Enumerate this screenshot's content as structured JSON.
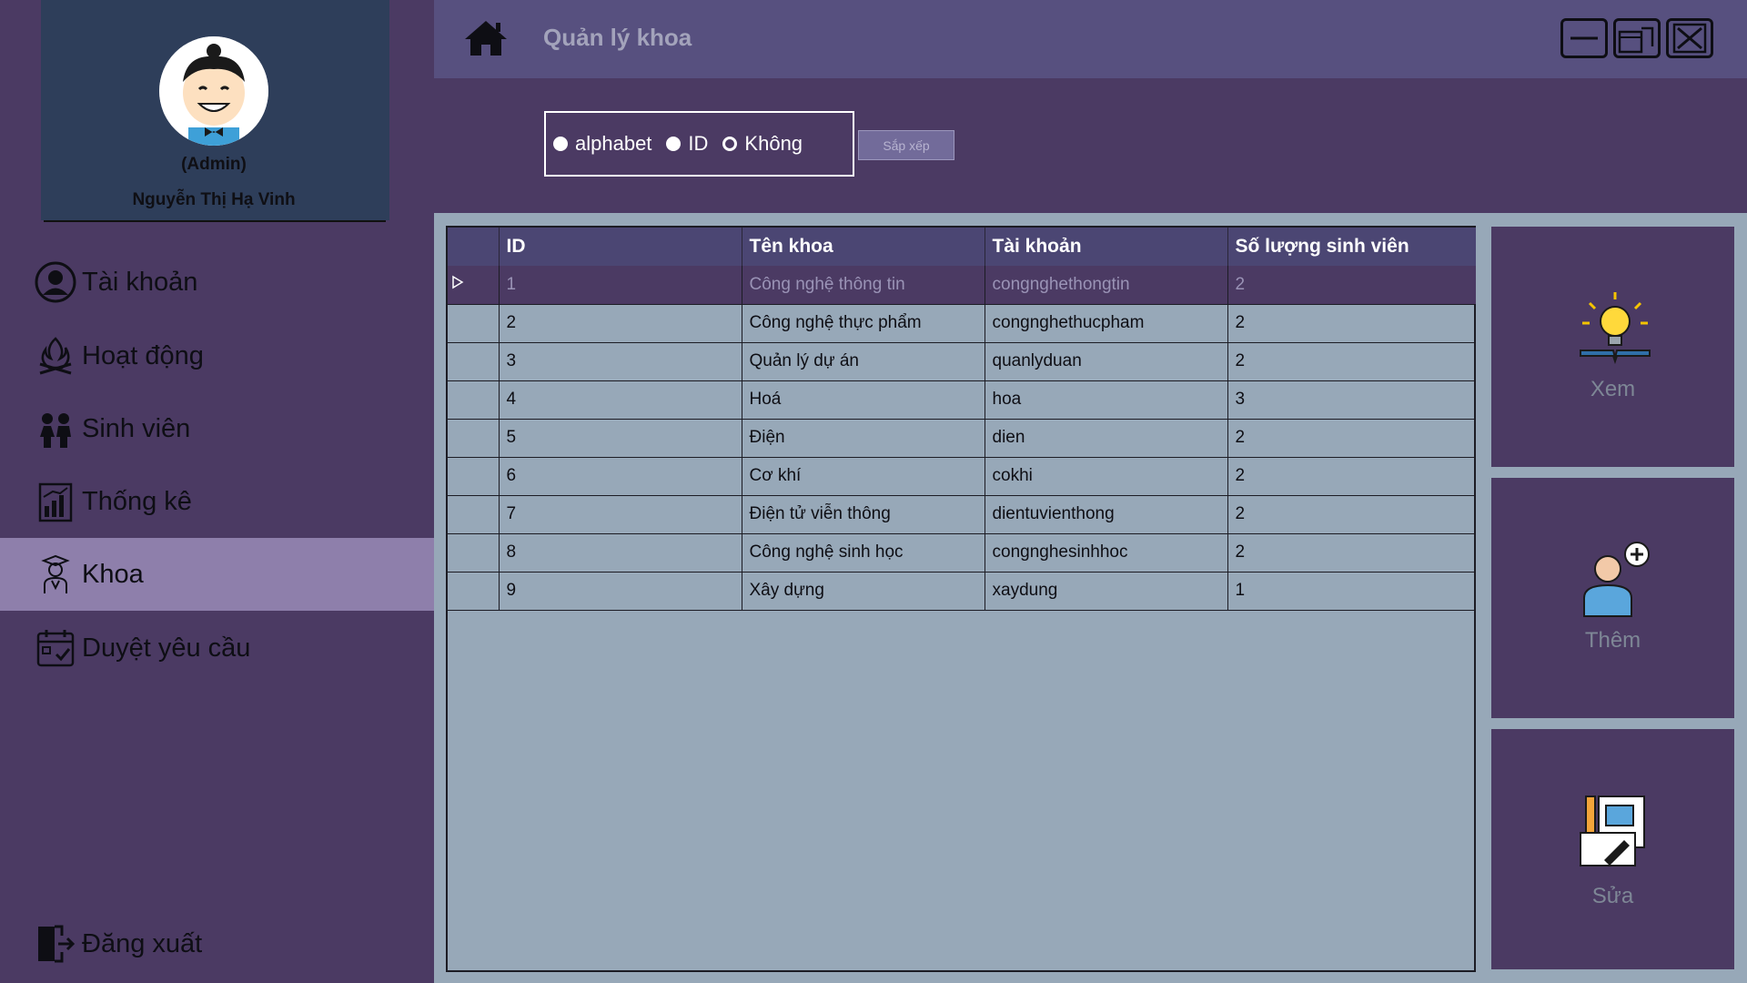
{
  "profile": {
    "role": "(Admin)",
    "name": "Nguyễn Thị Hạ Vinh",
    "avatar_icon": "cartoon-boy-avatar"
  },
  "sidebar": {
    "items": [
      {
        "label": "Tài khoản",
        "icon": "user-circle-icon"
      },
      {
        "label": "Hoạt động",
        "icon": "campfire-icon"
      },
      {
        "label": "Sinh viên",
        "icon": "students-icon"
      },
      {
        "label": "Thống kê",
        "icon": "bar-chart-icon"
      },
      {
        "label": "Khoa",
        "icon": "graduate-icon",
        "active": true
      },
      {
        "label": "Duyệt yêu cầu",
        "icon": "calendar-check-icon"
      }
    ],
    "logout_label": "Đăng xuất"
  },
  "header": {
    "title": "Quản lý khoa"
  },
  "sort": {
    "options": [
      "alphabet",
      "ID",
      "Không"
    ],
    "selected": "Không",
    "button_label": "Sắp xếp"
  },
  "table": {
    "columns": [
      "ID",
      "Tên khoa",
      "Tài khoản",
      "Số lượng sinh viên"
    ],
    "rows": [
      [
        "1",
        "Công nghệ thông tin",
        "congnghethongtin",
        "2"
      ],
      [
        "2",
        "Công nghệ thực phẩm",
        "congnghethucpham",
        "2"
      ],
      [
        "3",
        "Quản lý dự án",
        "quanlyduan",
        "2"
      ],
      [
        "4",
        "Hoá",
        "hoa",
        "3"
      ],
      [
        "5",
        "Điện",
        "dien",
        "2"
      ],
      [
        "6",
        "Cơ khí",
        "cokhi",
        "2"
      ],
      [
        "7",
        "Điện tử viễn thông",
        "dientuvienthong",
        "2"
      ],
      [
        "8",
        "Công nghệ sinh học",
        "congnghesinhhoc",
        "2"
      ],
      [
        "9",
        "Xây dựng",
        "xaydung",
        "1"
      ]
    ],
    "selected_row": 0
  },
  "actions": [
    {
      "label": "Xem",
      "icon": "lightbulb-book-icon"
    },
    {
      "label": "Thêm",
      "icon": "add-user-icon"
    },
    {
      "label": "Sửa",
      "icon": "edit-document-icon"
    }
  ],
  "colors": {
    "sidebar_bg": "#4b3a63",
    "active_item": "#8e7fab",
    "titlebar": "#57507f",
    "grid_bg": "#97a8b8"
  }
}
